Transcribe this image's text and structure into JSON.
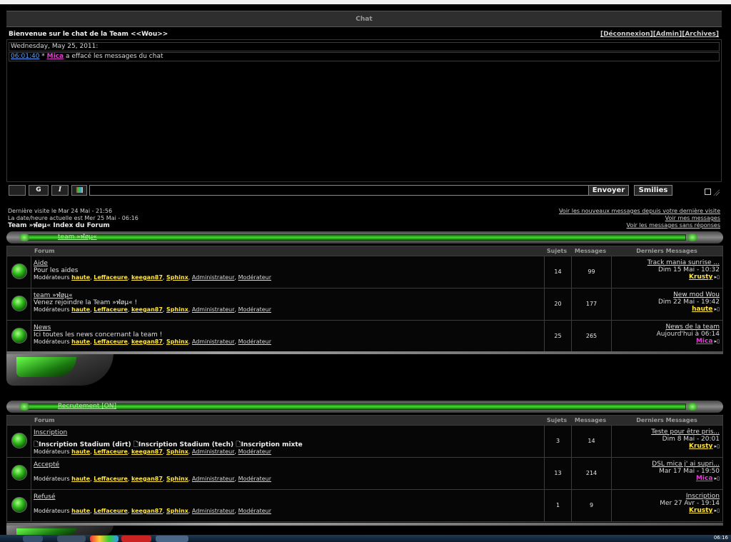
{
  "chat": {
    "title": "Chat",
    "welcome": "Bienvenue sur le chat de la Team <<Wou>>",
    "links": [
      "[Déconnexion]",
      "[Admin]",
      "[Archives]"
    ],
    "date_line": "Wednesday, May 25, 2011:",
    "message": {
      "time": "06:01:40",
      "star": " * ",
      "user": "Mica",
      "text": " a effacé les messages du chat"
    },
    "buttons": {
      "bold": "G",
      "italic": "I",
      "send": "Envoyer",
      "smilies": "Smilies"
    },
    "input_value": ""
  },
  "info": {
    "last_visit": "Dernière visite le Mar 24 Mai - 21:56",
    "current_time": "La date/heure actuelle est Mer 25 Mai - 06:16",
    "index": "Team »ฬøµ« Index du Forum",
    "links": [
      "Voir les nouveaux messages depuis votre dernière visite",
      "Voir mes messages",
      "Voir les messages sans réponses"
    ]
  },
  "columns": {
    "forum": "Forum",
    "sujets": "Sujets",
    "messages": "Messages",
    "derniers": "Derniers Messages"
  },
  "moderators_label": "Modérateurs",
  "moderators": [
    "haute",
    "Leffaceure",
    "keegan87",
    "Sphinx"
  ],
  "moderator_groups": [
    "Administrateur",
    "Modérateur"
  ],
  "categories": [
    {
      "name": "team »ฬøµ«",
      "forums": [
        {
          "name": "Aide",
          "desc": "Pour les aides",
          "sujets": "14",
          "messages": "99",
          "last_title": "Track mania sunrise ...",
          "last_date": "Dim 15 Mai - 10:32",
          "last_user": "Krusty"
        },
        {
          "name": "team »ฬøµ«",
          "desc": "Venez rejoindre la Team »ฬøµ« !",
          "sujets": "20",
          "messages": "177",
          "last_title": "New mod Wou",
          "last_date": "Dim 22 Mai - 19:42",
          "last_user": "haute"
        },
        {
          "name": "News",
          "desc": "Ici toutes les news concernant la team !",
          "sujets": "25",
          "messages": "265",
          "last_title": "News de la team",
          "last_date": "Aujourd'hui à 06:14",
          "last_user": "Mica"
        }
      ]
    },
    {
      "name": "Recrutement [ON]",
      "forums": [
        {
          "name": "Inscription",
          "subforums": [
            "Inscription Stadium (dirt)",
            "Inscription Stadium (tech)",
            "Inscription mixte"
          ],
          "sujets": "3",
          "messages": "14",
          "last_title": "Teste pour être pris...",
          "last_date": "Dim 8 Mai - 20:01",
          "last_user": "Krusty"
        },
        {
          "name": "Accepté",
          "desc": "",
          "sujets": "13",
          "messages": "214",
          "last_title": "DSL mica j' ai supri...",
          "last_date": "Mar 17 Mai - 19:50",
          "last_user": "Mica"
        },
        {
          "name": "Refusé",
          "desc": "",
          "sujets": "1",
          "messages": "9",
          "last_title": "Inscription",
          "last_date": "Mer 27 Avr - 19:14",
          "last_user": "Krusty"
        }
      ]
    }
  ],
  "user_colors": {
    "Krusty": "#ffe53a",
    "haute": "#ffe53a",
    "Mica": "#e040d0"
  },
  "taskbar": {
    "clock": "06:16"
  }
}
